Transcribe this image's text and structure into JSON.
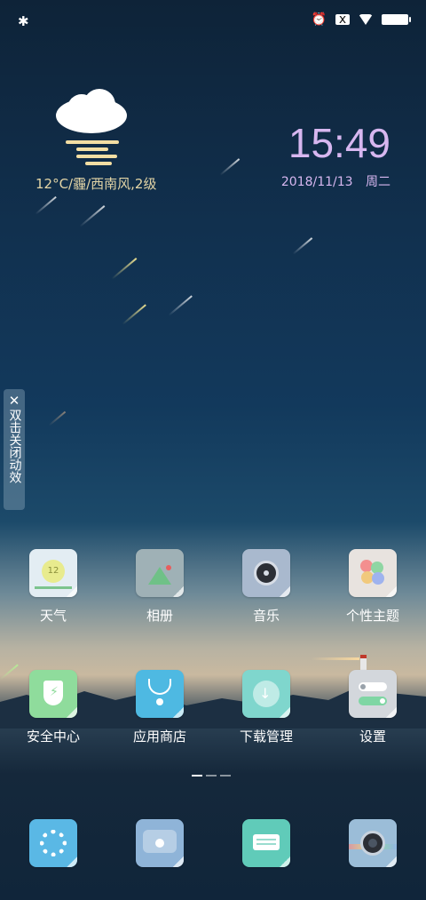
{
  "status": {
    "bluetooth": "bluetooth-icon",
    "alarm": "alarm-icon",
    "notice": "x",
    "wifi": "wifi-icon",
    "battery": "battery-icon"
  },
  "weather": {
    "text": "12°C/霾/西南风,2级",
    "icon": "cloudy-fog-icon"
  },
  "clock": {
    "time": "15:49",
    "date": "2018/11/13",
    "weekday": "周二"
  },
  "side_tab": {
    "close": "✕",
    "text": "双击关闭动效"
  },
  "apps_row1": [
    {
      "label": "天气",
      "icon": "weather-icon",
      "bg": "#e3edf3"
    },
    {
      "label": "相册",
      "icon": "gallery-icon",
      "bg": "#9fb1b6"
    },
    {
      "label": "音乐",
      "icon": "music-icon",
      "bg": "#a9b9ce"
    },
    {
      "label": "个性主题",
      "icon": "theme-icon",
      "bg": "#e8e3df"
    }
  ],
  "apps_row2": [
    {
      "label": "安全中心",
      "icon": "security-icon",
      "bg": "#8fdc9c"
    },
    {
      "label": "应用商店",
      "icon": "app-store-icon",
      "bg": "#4eb9e2"
    },
    {
      "label": "下载管理",
      "icon": "download-icon",
      "bg": "#7fd6cd"
    },
    {
      "label": "设置",
      "icon": "settings-icon",
      "bg": "#d3d7dc"
    }
  ],
  "dock": [
    {
      "icon": "phone-dialer-icon",
      "bg": "#5ab8e5"
    },
    {
      "icon": "browser-icon",
      "bg": "#8fb4d8"
    },
    {
      "icon": "messages-icon",
      "bg": "#60cbb9"
    },
    {
      "icon": "camera-icon",
      "bg": "#9bbdd8"
    }
  ],
  "page_indicator": {
    "count": 3,
    "active": 0
  }
}
